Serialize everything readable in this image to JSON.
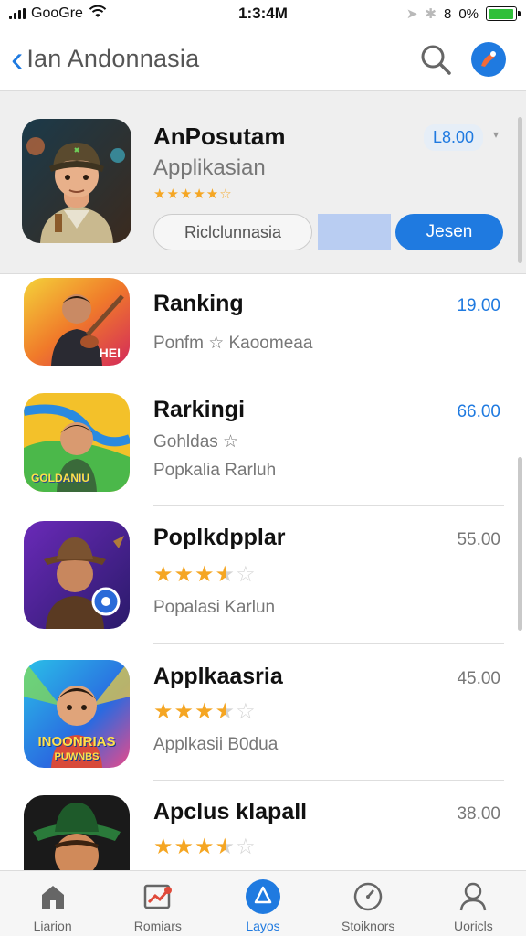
{
  "status_bar": {
    "carrier": "GooGre",
    "time": "1:3:4M",
    "bluetooth": "8",
    "battery": "0%",
    "battery_level": 0.95
  },
  "nav": {
    "title": "Ian Andonnasia"
  },
  "featured": {
    "name": "AnPosutam",
    "subtitle": "Applikasian",
    "stars": "★★★★★☆",
    "price": "L8.00",
    "secondary_button": "Riclclunnasia",
    "primary_button": "Jesen"
  },
  "apps": [
    {
      "name": "Ranking",
      "price": "19.00",
      "price_style": "blue",
      "line1": "Ponfm ☆ Kaoomeaa",
      "line2": ""
    },
    {
      "name": "Rarkingi",
      "price": "66.00",
      "price_style": "blue",
      "line1": "Gohldas ☆",
      "line2": "Popkalia Rarluh"
    },
    {
      "name": "Poplkdpplar",
      "price": "55.00",
      "price_style": "gray",
      "rating": 3.5,
      "line2": "Popalasi Karlun"
    },
    {
      "name": "Applkaasria",
      "price": "45.00",
      "price_style": "gray",
      "rating": 3.5,
      "line2": "Applkasii B0dua"
    },
    {
      "name": "Apclus klapall",
      "price": "38.00",
      "price_style": "gray",
      "rating": 3.5,
      "line2": ""
    }
  ],
  "icon_texts": {
    "app1": "HEI",
    "app2": "GOLDANIU",
    "app4_line1": "INOONRIAS",
    "app4_line2": "PUWNBS"
  },
  "tabs": [
    {
      "label": "Liarion",
      "icon": "home-icon"
    },
    {
      "label": "Romiars",
      "icon": "charts-icon"
    },
    {
      "label": "Layos",
      "icon": "explore-icon",
      "active": true
    },
    {
      "label": "Stoiknors",
      "icon": "timer-icon"
    },
    {
      "label": "Uoricls",
      "icon": "person-icon"
    }
  ],
  "colors": {
    "accent": "#1f7ae0",
    "star": "#f5a623",
    "battery": "#2fbf3a"
  }
}
